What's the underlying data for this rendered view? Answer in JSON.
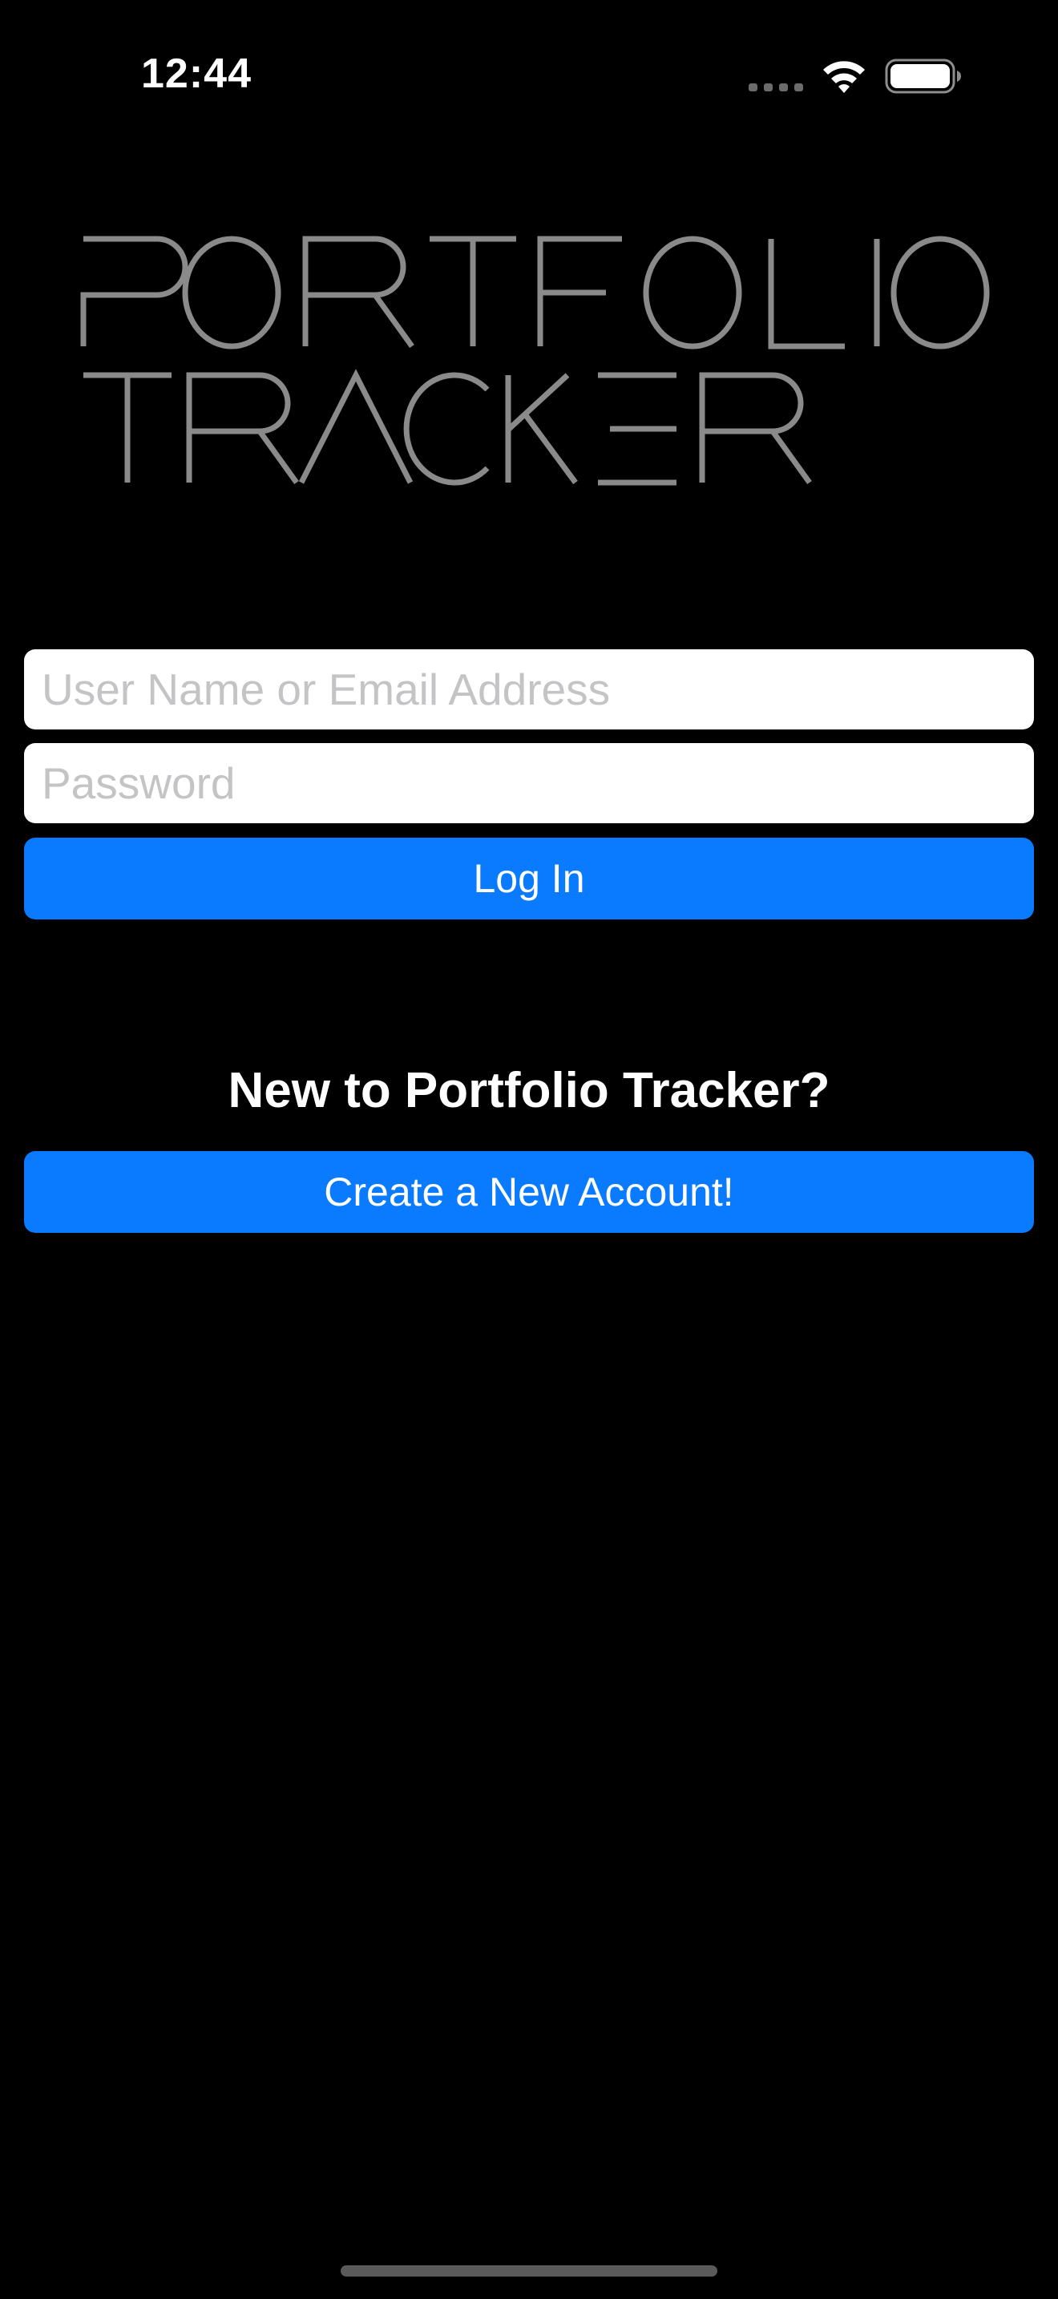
{
  "status_bar": {
    "time": "12:44",
    "signal_icon": "cellular-signal-dots",
    "wifi_icon": "wifi-icon",
    "battery_icon": "battery-icon"
  },
  "logo": {
    "line1": "PORTFOLIO",
    "line2": "TRACKER",
    "color": "#8a8a8a"
  },
  "login_form": {
    "username_placeholder": "User Name or Email Address",
    "username_value": "",
    "password_placeholder": "Password",
    "password_value": "",
    "login_label": "Log In"
  },
  "signup": {
    "heading": "New to Portfolio Tracker?",
    "create_label": "Create a New Account!"
  },
  "colors": {
    "background": "#000000",
    "accent": "#0a7aff",
    "field_background": "#ffffff",
    "placeholder": "#c4c4c6"
  }
}
